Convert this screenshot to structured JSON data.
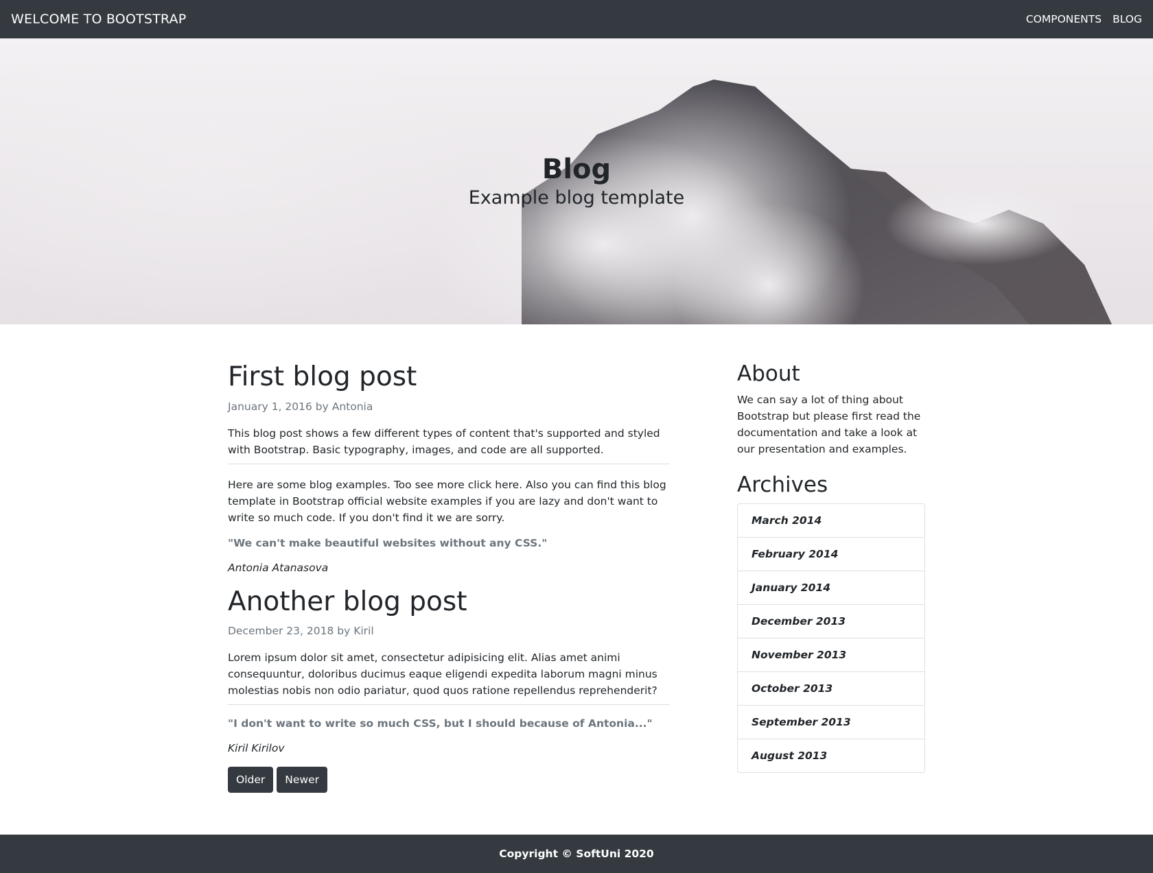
{
  "navbar": {
    "brand": "WELCOME TO BOOTSTRAP",
    "links": [
      "COMPONENTS",
      "BLOG"
    ]
  },
  "hero": {
    "title": "Blog",
    "subtitle": "Example blog template"
  },
  "posts": [
    {
      "title": "First blog post",
      "meta": "January 1, 2016 by Antonia",
      "intro": "This blog post shows a few different types of content that's supported and styled with Bootstrap. Basic typography, images, and code are all supported.",
      "body": "Here are some blog examples. Too see more click here. Also you can find this blog template in Bootstrap official website examples if you are lazy and don't want to write so much code. If you don't find it we are sorry.",
      "quote": "\"We can't make beautiful websites without any CSS.\"",
      "author": "Antonia Atanasova"
    },
    {
      "title": "Another blog post",
      "meta": "December 23, 2018 by Kiril",
      "intro": "Lorem ipsum dolor sit amet, consectetur adipisicing elit. Alias amet animi consequuntur, doloribus ducimus eaque eligendi expedita laborum magni minus molestias nobis non odio pariatur, quod quos ratione repellendus reprehenderit?",
      "quote": "\"I don't want to write so much CSS, but I should because of Antonia...\"",
      "author": "Kiril Kirilov"
    }
  ],
  "pagination": {
    "older": "Older",
    "newer": "Newer"
  },
  "sidebar": {
    "about_title": "About",
    "about_text": "We can say a lot of thing about Bootstrap but please first read the documentation and take a look at our presentation and examples.",
    "archives_title": "Archives",
    "archives": [
      "March 2014",
      "February 2014",
      "January 2014",
      "December 2013",
      "November 2013",
      "October 2013",
      "September 2013",
      "August 2013"
    ]
  },
  "footer": {
    "text": "Copyright © SoftUni 2020"
  },
  "colors": {
    "nav_bg": "#343a40",
    "muted": "#6c757d",
    "text": "#212529"
  }
}
